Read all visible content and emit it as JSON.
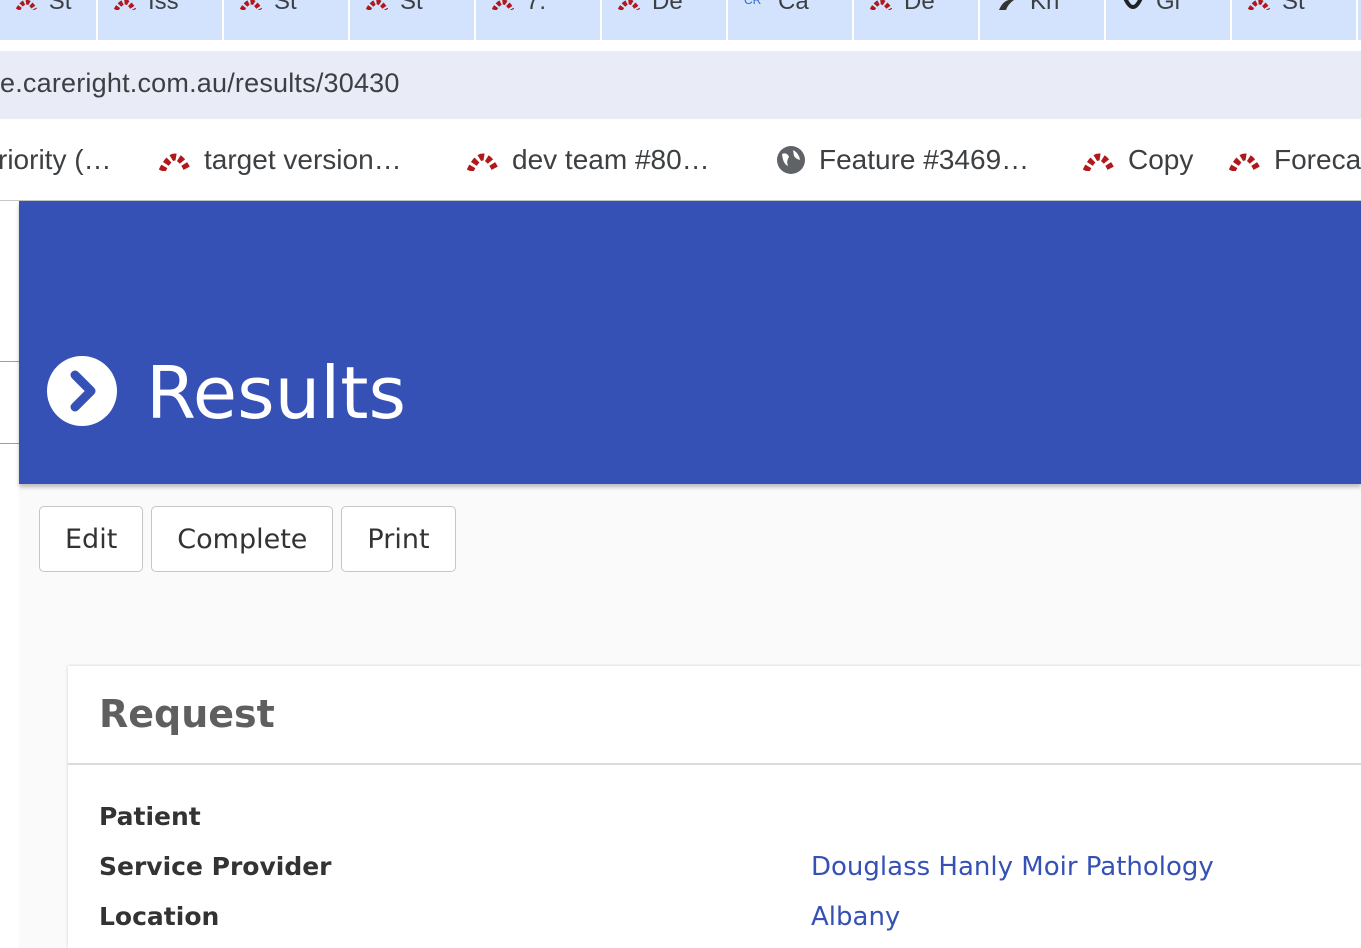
{
  "browser": {
    "tabs": [
      {
        "label": "St",
        "icon": "redmine-icon"
      },
      {
        "label": "Iss",
        "icon": "redmine-icon"
      },
      {
        "label": "St",
        "icon": "redmine-icon"
      },
      {
        "label": "St",
        "icon": "redmine-icon"
      },
      {
        "label": "7.",
        "icon": "redmine-icon"
      },
      {
        "label": "De",
        "icon": "redmine-icon"
      },
      {
        "label": "Ca",
        "icon": "careright-icon"
      },
      {
        "label": "De",
        "icon": "redmine-icon"
      },
      {
        "label": "Kn",
        "icon": "bird-icon"
      },
      {
        "label": "Gi",
        "icon": "github-icon"
      },
      {
        "label": "St",
        "icon": "redmine-icon"
      }
    ],
    "url": "e.careright.com.au/results/30430",
    "bookmarks": [
      {
        "label": "riority (…",
        "icon": "none"
      },
      {
        "label": "target version…",
        "icon": "redmine-icon"
      },
      {
        "label": "dev team #80…",
        "icon": "redmine-icon"
      },
      {
        "label": "Feature #3469…",
        "icon": "globe-icon"
      },
      {
        "label": "Copy",
        "icon": "redmine-icon"
      },
      {
        "label": "Foreca",
        "icon": "redmine-icon"
      }
    ]
  },
  "page": {
    "title": "Results",
    "actions": {
      "edit": "Edit",
      "complete": "Complete",
      "print": "Print"
    },
    "request": {
      "heading": "Request",
      "rows": [
        {
          "label": "Patient",
          "value": ""
        },
        {
          "label": "Service Provider",
          "value": "Douglass Hanly Moir Pathology"
        },
        {
          "label": "Location",
          "value": "Albany"
        }
      ]
    }
  },
  "colors": {
    "banner": "#3651b5",
    "link": "#3651b5",
    "tabstrip": "#d3e3fd",
    "redmine": "#b0191c"
  }
}
